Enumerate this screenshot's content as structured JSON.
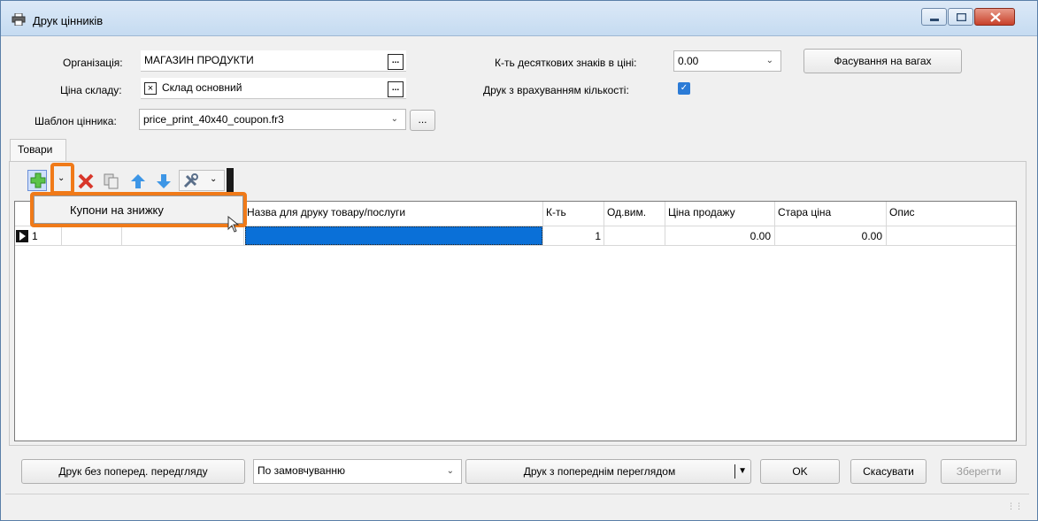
{
  "window": {
    "title": "Друк цінників",
    "icon": "printer-icon"
  },
  "form": {
    "org_label": "Організація:",
    "org_value": "МАГАЗИН ПРОДУКТИ",
    "price_label": "Ціна складу:",
    "price_value": "Склад основний",
    "template_label": "Шаблон цінника:",
    "template_value": "price_print_40x40_coupon.fr3",
    "decimals_label": "К-ть десяткових знаків в ціні:",
    "decimals_value": "0.00",
    "qty_print_label": "Друк з врахуванням кількості:",
    "qty_print_checked": true,
    "weigh_button": "Фасування на вагах",
    "browse_label": "..."
  },
  "tabs": {
    "goods": "Товари"
  },
  "toolbar": {
    "icons": [
      "add-icon",
      "dropdown-arrow-icon",
      "delete-icon",
      "copy-icon",
      "arrow-up-icon",
      "arrow-down-icon",
      "tools-icon"
    ]
  },
  "dropdown_menu": {
    "item": "Купони на знижку"
  },
  "table": {
    "columns": [
      "Назва для друку товару/послуги",
      "К-ть",
      "Од.вим.",
      "Ціна продажу",
      "Стара ціна",
      "Опис"
    ],
    "rows": [
      {
        "n": "1",
        "name": "",
        "qty": "1",
        "unit": "",
        "price": "0.00",
        "old_price": "0.00",
        "desc": ""
      }
    ]
  },
  "footer": {
    "print_no_preview": "Друк без поперед. передгляду",
    "default_option": "По замовчуванню",
    "print_with_preview": "Друк з попереднім переглядом",
    "ok": "OK",
    "cancel": "Скасувати",
    "save": "Зберегти"
  },
  "colors": {
    "accent": "#2b7bd6",
    "highlight_outline": "#f07a19",
    "selected_cell": "#0a70d8"
  }
}
